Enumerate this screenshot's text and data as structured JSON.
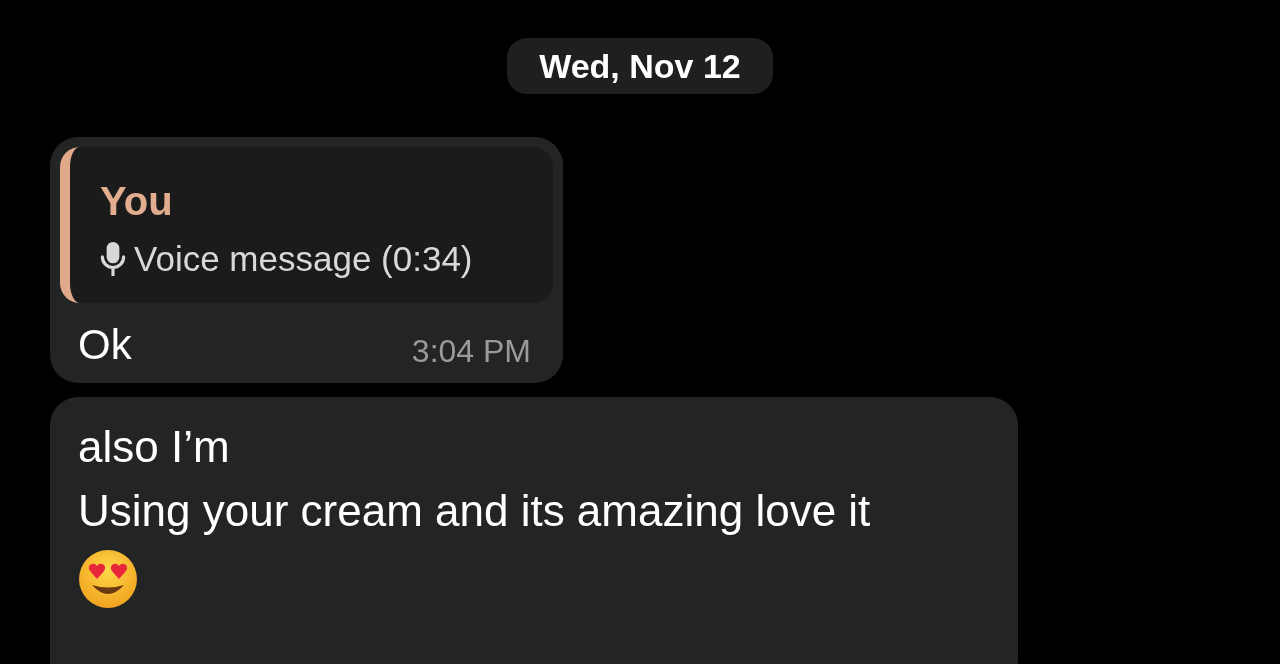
{
  "date_separator": "Wed, Nov 12",
  "messages": [
    {
      "kind": "reply",
      "quote": {
        "author": "You",
        "attachment": "Voice message (0:34)"
      },
      "lines": [
        "Ok"
      ],
      "time": "3:04 PM"
    },
    {
      "kind": "text",
      "lines": [
        "also I’m",
        "Using your cream and its amazing love it"
      ],
      "emoji": true
    }
  ]
}
